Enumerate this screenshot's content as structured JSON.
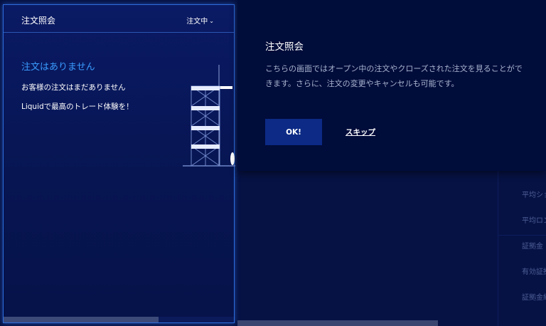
{
  "colors": {
    "background": "#05103c",
    "panel_border": "#2c6cdb",
    "accent_blue": "#3a9bff",
    "tooltip_bg": "#000c3a",
    "ok_button_bg": "#0c2a86"
  },
  "orders_panel": {
    "title": "注文照会",
    "filter_label": "注文中",
    "filter_icon": "chevron-down-icon",
    "empty_title": "注文はありません",
    "empty_message": "お客様の注文はまだありません",
    "empty_cta": "Liquidで最高のトレード体験を！",
    "illustration": "scaffold-illustration"
  },
  "tooltip": {
    "title": "注文照会",
    "body": "こちらの画面ではオープン中の注文やクローズされた注文を見ることができます。さらに、注文の変更やキャンセルも可能です。",
    "ok_label": "OK!",
    "skip_label": "スキップ"
  },
  "background_labels": [
    "平均ショ",
    "平均ロン",
    "証拠金",
    "有効証拠",
    "証拠金維"
  ]
}
